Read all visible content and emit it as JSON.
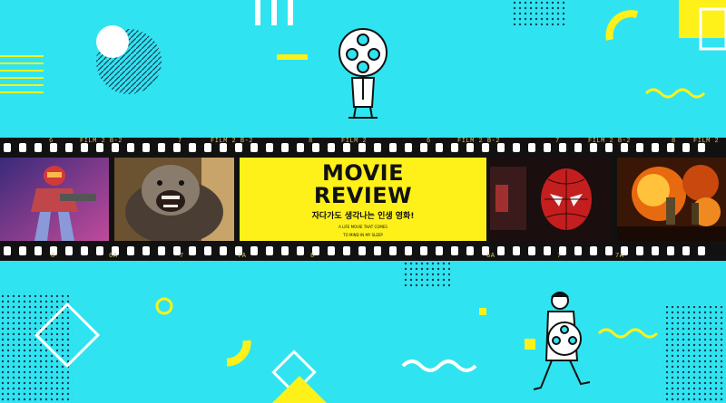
{
  "title_card": {
    "line1": "MOVIE",
    "line2": "REVIEW",
    "korean_subtitle": "자다가도 생각나는 인생 영화!",
    "english_line1": "A LIFE MOVIE THAT COMES",
    "english_line2": "TO MIND IN MY SLEEP"
  },
  "film_edge_labels": {
    "top": [
      "6",
      "FILM 2  B-2",
      "7",
      "FILM 2  B-2",
      "8",
      "FILM 2",
      "6",
      "FILM 2  B-2",
      "7",
      "FILM 2  B-2",
      "8",
      "FILM 2"
    ],
    "bottom": [
      "8",
      "6A",
      "7",
      "7A",
      "8",
      "6A",
      "7",
      "7A"
    ]
  },
  "frames": [
    {
      "subject": "armored-soldier-figure"
    },
    {
      "subject": "gorilla-figure"
    },
    {
      "subject": "spider-hero-figure"
    },
    {
      "subject": "explosion-battle-scene"
    }
  ],
  "colors": {
    "background": "#2fe4f0",
    "accent_yellow": "#fdf119",
    "film": "#111111",
    "ink": "#111111"
  }
}
